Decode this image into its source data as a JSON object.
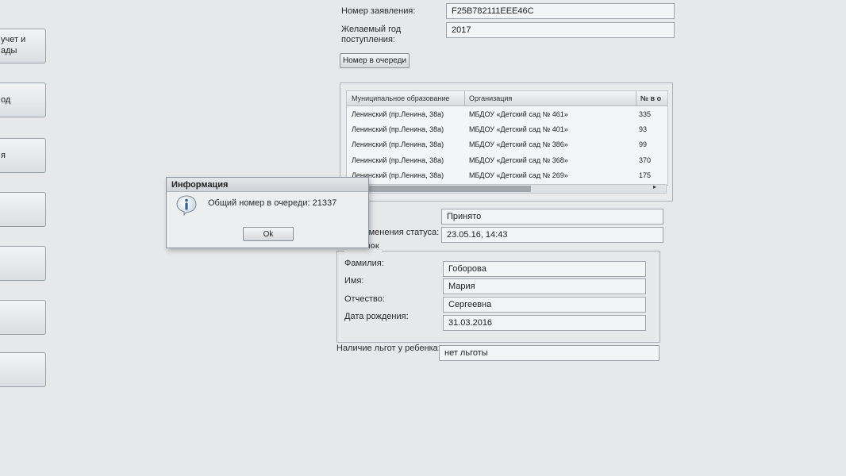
{
  "sidebar": {
    "items": [
      {
        "line1": "учет и",
        "line2": "ады"
      },
      {
        "line1": "од",
        "line2": ""
      },
      {
        "line1": "я",
        "line2": ""
      },
      {
        "line1": "",
        "line2": ""
      },
      {
        "line1": "",
        "line2": ""
      },
      {
        "line1": "",
        "line2": ""
      },
      {
        "line1": "",
        "line2": ""
      }
    ]
  },
  "form": {
    "application_number_label": "Номер заявления:",
    "application_number_value": "F25B782111EEE46C",
    "desired_year_label_1": "Желаемый год",
    "desired_year_label_2": "поступления:",
    "desired_year_value": "2017",
    "queue_button_label": "Номер в очереди"
  },
  "queue_grid": {
    "columns": [
      "Муниципальное образование",
      "Организация",
      "№ в о"
    ],
    "rows": [
      {
        "municipality": "Ленинский (пр.Ленина, 38а)",
        "organization": "МБДОУ «Детский сад № 461»",
        "number": "335"
      },
      {
        "municipality": "Ленинский (пр.Ленина, 38а)",
        "organization": "МБДОУ «Детский сад № 401»",
        "number": "93"
      },
      {
        "municipality": "Ленинский (пр.Ленина, 38а)",
        "organization": "МБДОУ «Детский сад № 386»",
        "number": "99"
      },
      {
        "municipality": "Ленинский (пр.Ленина, 38а)",
        "organization": "МБДОУ «Детский сад № 368»",
        "number": "370"
      },
      {
        "municipality": "Ленинский (пр.Ленина, 38а)",
        "organization": "МБДОУ «Детский сад № 269»",
        "number": "175"
      }
    ],
    "scroll_right_arrow": "▸"
  },
  "status": {
    "status_value": "Принято",
    "status_date_label": "Дата изменения статуса:",
    "status_date_value": "23.05.16, 14:43"
  },
  "child": {
    "legend": "Ребенок",
    "last_name_label": "Фамилия:",
    "last_name_value": "Гоборова",
    "first_name_label": "Имя:",
    "first_name_value": "Мария",
    "patronymic_label": "Отчество:",
    "patronymic_value": "Сергеевна",
    "birth_date_label": "Дата рождения:",
    "birth_date_value": "31.03.2016"
  },
  "benefits": {
    "label": "Наличие льгот у ребенка:",
    "value": "нет льготы"
  },
  "dialog": {
    "title": "Информация",
    "icon": "info-icon",
    "message": "Общий номер в очереди: 21337",
    "ok_label": "Ok"
  }
}
